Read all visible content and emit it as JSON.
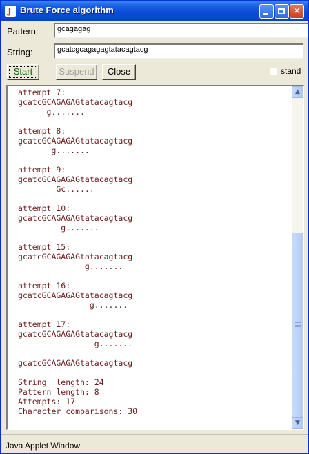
{
  "window": {
    "title": "Brute Force algorithm",
    "icons": {
      "app": "java-icon",
      "minimize": "minimize-icon",
      "maximize": "maximize-icon",
      "close": "close-icon"
    }
  },
  "form": {
    "pattern_label": "Pattern:",
    "pattern_value": "gcagagag",
    "string_label": "String:",
    "string_value": "gcatcgcagagagtatacagtacg"
  },
  "toolbar": {
    "start_label": "Start",
    "suspend_label": "Suspend",
    "close_label": "Close",
    "stand_label": "stand",
    "stand_checked": false
  },
  "output_lines": [
    "attempt 7:",
    "gcatcGCAGAGAGtatacagtacg",
    "      g.......",
    "",
    "attempt 8:",
    "gcatcGCAGAGAGtatacagtacg",
    "       g.......",
    "",
    "attempt 9:",
    "gcatcGCAGAGAGtatacagtacg",
    "        Gc......",
    "",
    "attempt 10:",
    "gcatcGCAGAGAGtatacagtacg",
    "         g.......",
    "",
    "attempt 15:",
    "gcatcGCAGAGAGtatacagtacg",
    "              g.......",
    "",
    "attempt 16:",
    "gcatcGCAGAGAGtatacagtacg",
    "               g.......",
    "",
    "attempt 17:",
    "gcatcGCAGAGAGtatacagtacg",
    "                g.......",
    "",
    "gcatcGCAGAGAGtatacagtacg",
    "",
    "String  length: 24",
    "Pattern length: 8",
    "Attempts: 17",
    "Character comparisons: 30"
  ],
  "scrollbar": {
    "up_icon": "scroll-up-icon",
    "down_icon": "scroll-down-icon"
  },
  "status": {
    "text": "Java Applet Window"
  }
}
